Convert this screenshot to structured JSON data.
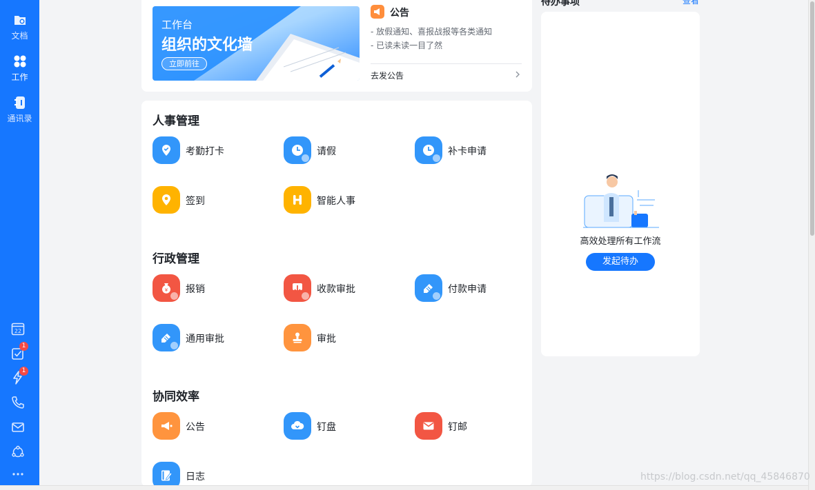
{
  "sidebar": {
    "items": [
      {
        "label": "文档",
        "icon": "folder-icon"
      },
      {
        "label": "工作",
        "icon": "grid-icon"
      },
      {
        "label": "通讯录",
        "icon": "contacts-icon"
      }
    ],
    "bottom_icons": [
      {
        "icon": "calendar-icon",
        "text": "22"
      },
      {
        "icon": "todo-check-icon",
        "badge": "1"
      },
      {
        "icon": "ding-lightning-icon",
        "badge": "1"
      },
      {
        "icon": "phone-icon"
      },
      {
        "icon": "mail-icon"
      },
      {
        "icon": "network-icon"
      },
      {
        "icon": "more-icon"
      }
    ]
  },
  "banner": {
    "subtitle": "工作台",
    "title": "组织的文化墙",
    "button": "立即前往"
  },
  "announcement": {
    "title": "公告",
    "lines": [
      "- 放假通知、喜报战报等各类通知",
      "- 已读未读一目了然"
    ],
    "go_label": "去发公告"
  },
  "sections": [
    {
      "title": "人事管理",
      "apps": [
        {
          "label": "考勤打卡",
          "icon": "location-check-icon",
          "color": "#3296fa"
        },
        {
          "label": "请假",
          "icon": "clock-icon",
          "color": "#3296fa"
        },
        {
          "label": "补卡申请",
          "icon": "clock-icon",
          "color": "#3296fa"
        },
        {
          "label": "签到",
          "icon": "location-pin-icon",
          "color": "#ffb300"
        },
        {
          "label": "智能人事",
          "icon": "h-logo-icon",
          "color": "#ffb300"
        }
      ]
    },
    {
      "title": "行政管理",
      "apps": [
        {
          "label": "报销",
          "icon": "money-bag-icon",
          "color": "#f25643"
        },
        {
          "label": "收款审批",
          "icon": "download-icon",
          "color": "#f25643"
        },
        {
          "label": "付款申请",
          "icon": "pen-icon",
          "color": "#3296fa"
        },
        {
          "label": "通用审批",
          "icon": "pen-icon",
          "color": "#3296fa"
        },
        {
          "label": "审批",
          "icon": "stamp-icon",
          "color": "#ff943e"
        }
      ]
    },
    {
      "title": "协同效率",
      "apps": [
        {
          "label": "公告",
          "icon": "megaphone-icon",
          "color": "#ff943e"
        },
        {
          "label": "钉盘",
          "icon": "cloud-icon",
          "color": "#3296fa"
        },
        {
          "label": "钉邮",
          "icon": "mail-icon",
          "color": "#f25643"
        },
        {
          "label": "日志",
          "icon": "journal-icon",
          "color": "#3296fa"
        }
      ]
    }
  ],
  "todo": {
    "title": "待办事项",
    "link": "查看",
    "empty_text": "高效处理所有工作流",
    "button": "发起待办"
  },
  "watermark": "https://blog.csdn.net/qq_45846870",
  "colors": {
    "primary": "#1677ff",
    "badge": "#f54a45"
  }
}
